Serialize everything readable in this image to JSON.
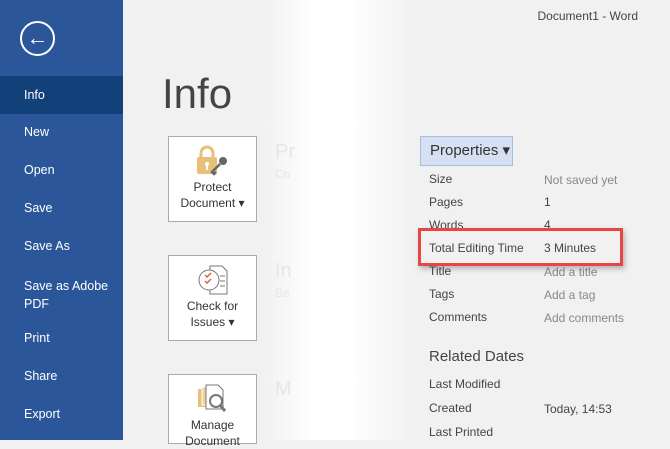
{
  "window_title": "Document1  -  Word",
  "sidebar": {
    "items": [
      {
        "label": "Info",
        "selected": true
      },
      {
        "label": "New"
      },
      {
        "label": "Open"
      },
      {
        "label": "Save"
      },
      {
        "label": "Save As"
      },
      {
        "label": "Save as Adobe PDF"
      },
      {
        "label": "Print"
      },
      {
        "label": "Share"
      },
      {
        "label": "Export"
      }
    ]
  },
  "page_title": "Info",
  "buttons": {
    "protect": "Protect Document ▾",
    "check": "Check for Issues ▾",
    "manage": "Manage Document"
  },
  "ghost": {
    "p_head": "Pr",
    "p_sub": "Co",
    "i_head": "In",
    "i_sub": "Be",
    "m_head": "M"
  },
  "properties": {
    "button": "Properties ▾",
    "rows": [
      {
        "label": "Size",
        "value": "Not saved yet"
      },
      {
        "label": "Pages",
        "value": "1"
      },
      {
        "label": "Words",
        "value": "4"
      },
      {
        "label": "Total Editing Time",
        "value": "3 Minutes"
      },
      {
        "label": "Title",
        "value": "Add a title"
      },
      {
        "label": "Tags",
        "value": "Add a tag"
      },
      {
        "label": "Comments",
        "value": "Add comments"
      }
    ]
  },
  "related_dates": {
    "title": "Related Dates",
    "rows": [
      {
        "label": "Last Modified",
        "value": ""
      },
      {
        "label": "Created",
        "value": "Today, 14:53"
      },
      {
        "label": "Last Printed",
        "value": ""
      }
    ]
  }
}
